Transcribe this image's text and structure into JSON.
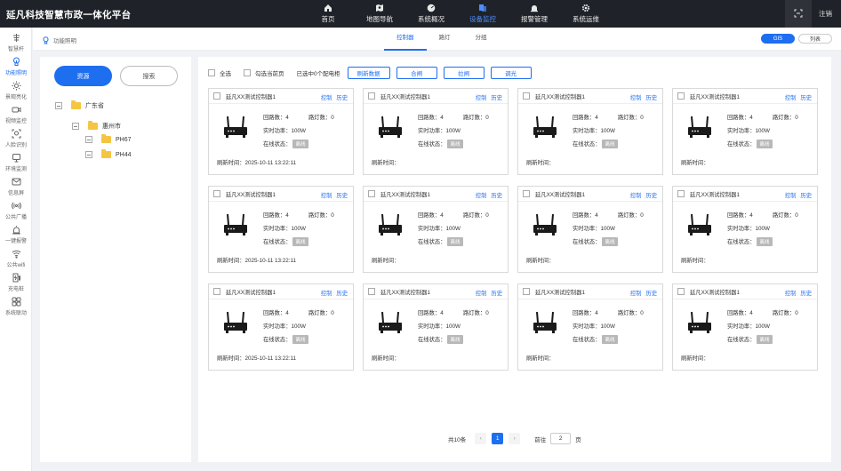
{
  "app_title": "延凡科技智慧市政一体化平台",
  "top_nav": [
    {
      "label": "首页",
      "icon": "home-icon",
      "active": false
    },
    {
      "label": "地图导航",
      "icon": "map-icon",
      "active": false
    },
    {
      "label": "系统概况",
      "icon": "dashboard-icon",
      "active": false
    },
    {
      "label": "设备监控",
      "icon": "device-icon",
      "active": true
    },
    {
      "label": "报警管理",
      "icon": "alarm-icon",
      "active": false
    },
    {
      "label": "系统运维",
      "icon": "gear-icon",
      "active": false
    }
  ],
  "logout_label": "注销",
  "sidebar": [
    {
      "label": "智慧杆",
      "icon": "smart-pole-icon",
      "active": false
    },
    {
      "label": "功能照明",
      "icon": "lighting-icon",
      "active": true
    },
    {
      "label": "景观亮化",
      "icon": "landscape-light-icon",
      "active": false
    },
    {
      "label": "视频监控",
      "icon": "camera-icon",
      "active": false
    },
    {
      "label": "人脸识别",
      "icon": "face-recognition-icon",
      "active": false
    },
    {
      "label": "环境监测",
      "icon": "environment-icon",
      "active": false
    },
    {
      "label": "信息屏",
      "icon": "info-screen-icon",
      "active": false
    },
    {
      "label": "公共广播",
      "icon": "broadcast-icon",
      "active": false
    },
    {
      "label": "一键报警",
      "icon": "one-key-alarm-icon",
      "active": false
    },
    {
      "label": "公共wifi",
      "icon": "wifi-icon",
      "active": false
    },
    {
      "label": "充电桩",
      "icon": "charging-pile-icon",
      "active": false
    },
    {
      "label": "系统联动",
      "icon": "linkage-icon",
      "active": false
    }
  ],
  "page_title": "功能照明",
  "sub_tabs": [
    {
      "label": "控制器",
      "active": true
    },
    {
      "label": "路灯",
      "active": false
    },
    {
      "label": "分组",
      "active": false
    }
  ],
  "view_toggle": {
    "gis": "GIS",
    "list": "列表"
  },
  "tree_panel": {
    "btn_resource": "资源",
    "btn_search": "搜索",
    "nodes": [
      {
        "label": "广东省",
        "level": 0
      },
      {
        "label": "惠州市",
        "level": 1
      },
      {
        "label": "PH67",
        "level": 2
      },
      {
        "label": "PH44",
        "level": 2
      }
    ]
  },
  "toolbar": {
    "select_all": "全选",
    "select_page": "勾选当前页",
    "selected_text": "已选中0个配电柜",
    "buttons": [
      "刷新数据",
      "合闸",
      "拉闸",
      "调光"
    ]
  },
  "card_template": {
    "control": "控制",
    "history": "历史",
    "circuits_label": "回路数：",
    "lamps_label": "路灯数：",
    "power_label": "实时功率：",
    "online_label": "在线状态：",
    "refresh_label": "刷新时间："
  },
  "cards": [
    {
      "name": "延凡XX测试控制器1",
      "circuits": "4",
      "lamps": "0",
      "power": "100W",
      "status": "离线",
      "refresh_time": "2025-10-11  13:22:11"
    },
    {
      "name": "延凡XX测试控制器1",
      "circuits": "4",
      "lamps": "0",
      "power": "100W",
      "status": "离线",
      "refresh_time": ""
    },
    {
      "name": "延凡XX测试控制器1",
      "circuits": "4",
      "lamps": "0",
      "power": "100W",
      "status": "离线",
      "refresh_time": ""
    },
    {
      "name": "延凡XX测试控制器1",
      "circuits": "4",
      "lamps": "0",
      "power": "100W",
      "status": "离线",
      "refresh_time": ""
    },
    {
      "name": "延凡XX测试控制器1",
      "circuits": "4",
      "lamps": "0",
      "power": "100W",
      "status": "离线",
      "refresh_time": "2025-10-11  13:22:11"
    },
    {
      "name": "延凡XX测试控制器1",
      "circuits": "4",
      "lamps": "0",
      "power": "100W",
      "status": "离线",
      "refresh_time": ""
    },
    {
      "name": "延凡XX测试控制器1",
      "circuits": "4",
      "lamps": "0",
      "power": "100W",
      "status": "离线",
      "refresh_time": ""
    },
    {
      "name": "延凡XX测试控制器1",
      "circuits": "4",
      "lamps": "0",
      "power": "100W",
      "status": "离线",
      "refresh_time": ""
    },
    {
      "name": "延凡XX测试控制器1",
      "circuits": "4",
      "lamps": "0",
      "power": "100W",
      "status": "离线",
      "refresh_time": "2025-10-11  13:22:11"
    },
    {
      "name": "延凡XX测试控制器1",
      "circuits": "4",
      "lamps": "0",
      "power": "100W",
      "status": "离线",
      "refresh_time": ""
    },
    {
      "name": "延凡XX测试控制器1",
      "circuits": "4",
      "lamps": "0",
      "power": "100W",
      "status": "离线",
      "refresh_time": ""
    },
    {
      "name": "延凡XX测试控制器1",
      "circuits": "4",
      "lamps": "0",
      "power": "100W",
      "status": "离线",
      "refresh_time": ""
    }
  ],
  "pagination": {
    "total": "共10条",
    "prev": "‹",
    "current": "1",
    "next": "›",
    "goto_label": "前往",
    "goto_value": "2",
    "page_unit": "页"
  },
  "colors": {
    "accent": "#1e6ef0",
    "topbar": "#1f2329",
    "offline_badge": "#b8b8b8",
    "folder": "#f5c542"
  }
}
